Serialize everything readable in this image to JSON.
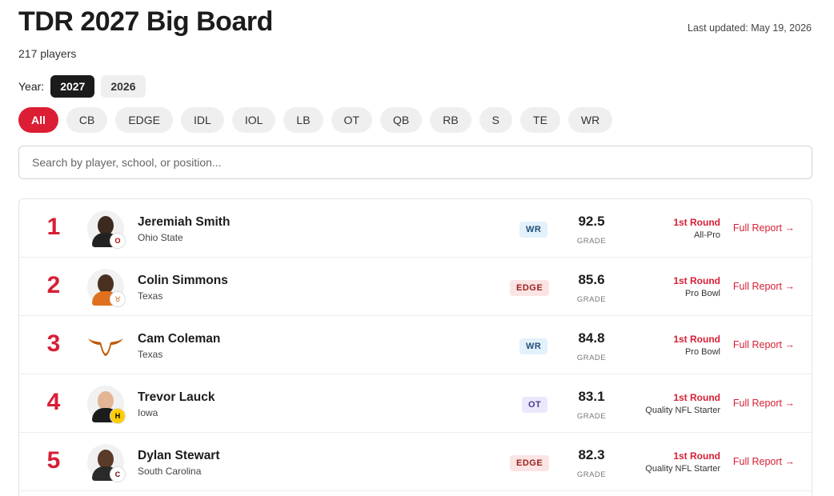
{
  "header": {
    "title": "TDR 2027 Big Board",
    "count": "217 players",
    "updated": "Last updated: May 19, 2026"
  },
  "year": {
    "label": "Year:",
    "options": [
      "2027",
      "2026"
    ],
    "selected": "2027"
  },
  "positions": {
    "options": [
      "All",
      "CB",
      "EDGE",
      "IDL",
      "IOL",
      "LB",
      "OT",
      "QB",
      "RB",
      "S",
      "TE",
      "WR"
    ],
    "selected": "All"
  },
  "search": {
    "placeholder": "Search by player, school, or position..."
  },
  "board": {
    "grade_label": "GRADE",
    "report_label": "Full Report →",
    "players": [
      {
        "rank": "1",
        "name": "Jeremiah Smith",
        "school": "Ohio State",
        "position": "WR",
        "grade": "92.5",
        "round": "1st Round",
        "tier": "All-Pro"
      },
      {
        "rank": "2",
        "name": "Colin Simmons",
        "school": "Texas",
        "position": "EDGE",
        "grade": "85.6",
        "round": "1st Round",
        "tier": "Pro Bowl"
      },
      {
        "rank": "3",
        "name": "Cam Coleman",
        "school": "Texas",
        "position": "WR",
        "grade": "84.8",
        "round": "1st Round",
        "tier": "Pro Bowl"
      },
      {
        "rank": "4",
        "name": "Trevor Lauck",
        "school": "Iowa",
        "position": "OT",
        "grade": "83.1",
        "round": "1st Round",
        "tier": "Quality NFL Starter"
      },
      {
        "rank": "5",
        "name": "Dylan Stewart",
        "school": "South Carolina",
        "position": "EDGE",
        "grade": "82.3",
        "round": "1st Round",
        "tier": "Quality NFL Starter"
      }
    ]
  },
  "colors": {
    "accent": "#dc1e35",
    "wr_bg": "#e3f1fb",
    "wr_fg": "#1f4f78",
    "edge_bg": "#fbe4e4",
    "edge_fg": "#9b2020",
    "ot_bg": "#ece8fb",
    "ot_fg": "#4b3b8f"
  }
}
